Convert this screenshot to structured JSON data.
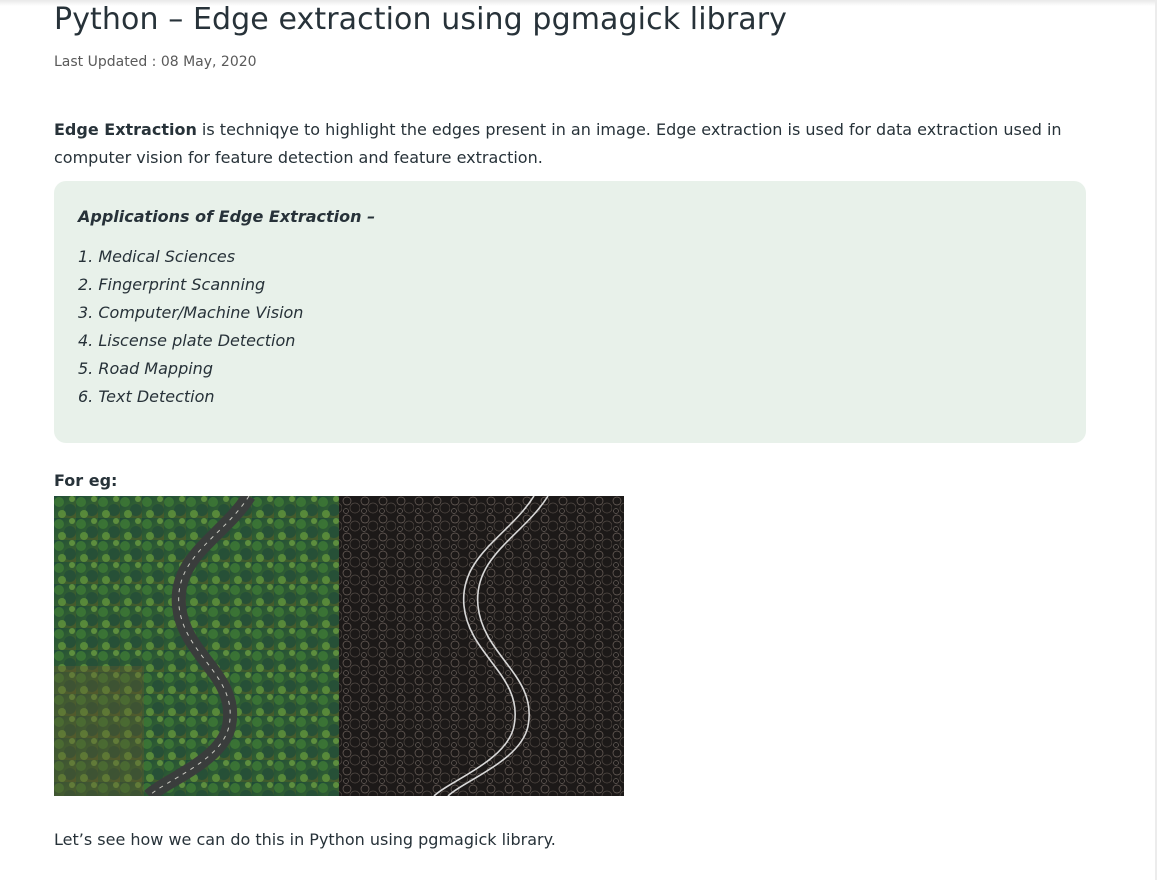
{
  "article": {
    "title": "Python – Edge extraction using pgmagick library",
    "last_updated": "Last Updated : 08 May, 2020",
    "intro_bold": "Edge Extraction",
    "intro_rest": " is techniqye to highlight the edges present in an image. Edge extraction is used for data extraction used in computer vision for feature detection and feature extraction.",
    "applications_title": "Applications of Edge Extraction –",
    "applications": [
      "1. Medical Sciences",
      "2. Fingerprint Scanning",
      "3. Computer/Machine Vision",
      "4. Liscense plate Detection",
      "5. Road Mapping",
      "6. Text Detection"
    ],
    "example_label": "For eg:",
    "outro": "Let’s see how we can do this in Python using pgmagick library."
  },
  "colors": {
    "text": "#273239",
    "box_bg": "#e8f1ea",
    "forest_dark": "#1d3f36",
    "forest_light": "#5f9a3b",
    "edge_bg": "#1e1b1a"
  }
}
